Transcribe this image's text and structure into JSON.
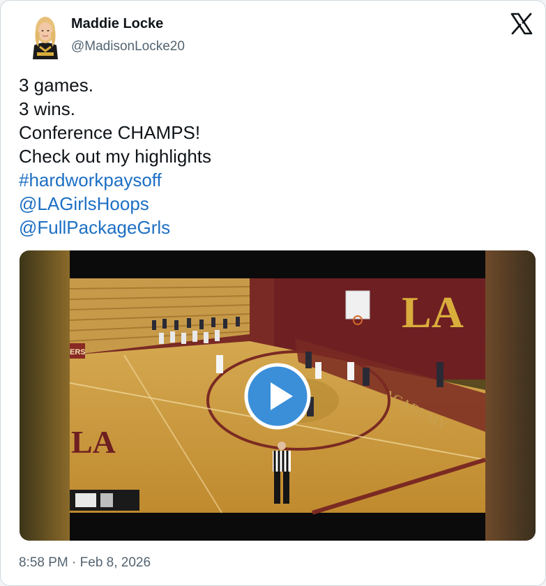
{
  "tweet": {
    "author_name": "Maddie Locke",
    "author_handle": "@MadisonLocke20",
    "lines": [
      "3 games.",
      "3 wins.",
      "Conference CHAMPS!",
      "Check out my highlights"
    ],
    "links": [
      "#hardworkpaysoff",
      "@LAGirlsHoops",
      "@FullPackageGrls"
    ],
    "timestamp": "8:58 PM · Feb 8, 2026",
    "media": {
      "type": "video",
      "court_logo": "LA",
      "baseline_text": "ACADEMY",
      "banner_text": "ERS"
    }
  },
  "icons": {
    "platform": "x-logo-icon",
    "play": "play-icon"
  },
  "colors": {
    "link": "#1d6fc4",
    "secondary_text": "#536471",
    "play_button": "#3b8fd9",
    "court_floor": "#c99a3a",
    "court_maroon": "#6e1f22",
    "logo_gold": "#d9ad3c"
  }
}
